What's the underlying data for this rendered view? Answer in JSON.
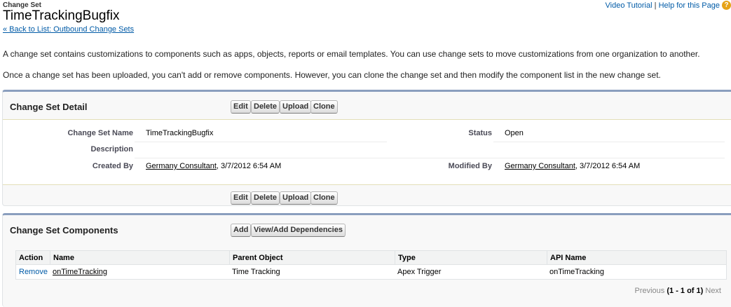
{
  "header": {
    "crumb": "Change Set",
    "title": "TimeTrackingBugfix",
    "back_link": "« Back to List: Outbound Change Sets"
  },
  "help": {
    "video": "Video Tutorial",
    "sep": "|",
    "help_page": "Help for this Page",
    "icon": "help-icon"
  },
  "intro": {
    "p1": "A change set contains customizations to components such as apps, objects, reports or email templates. You can use change sets to move customizations from one organization to another.",
    "p2": "Once a change set has been uploaded, you can't add or remove components. However, you can clone the change set and then modify the component list in the new change set."
  },
  "detail": {
    "title": "Change Set Detail",
    "buttons": {
      "edit": "Edit",
      "delete": "Delete",
      "upload": "Upload",
      "clone": "Clone"
    },
    "fields": {
      "name_label": "Change Set Name",
      "name_value": "TimeTrackingBugfix",
      "status_label": "Status",
      "status_value": "Open",
      "description_label": "Description",
      "created_label": "Created By",
      "created_user": "Germany Consultant",
      "created_date": ", 3/7/2012 6:54 AM",
      "modified_label": "Modified By",
      "modified_user": "Germany Consultant",
      "modified_date": ", 3/7/2012 6:54 AM"
    }
  },
  "components": {
    "title": "Change Set Components",
    "buttons": {
      "add": "Add",
      "dependencies": "View/Add Dependencies"
    },
    "columns": [
      "Action",
      "Name",
      "Parent Object",
      "Type",
      "API Name"
    ],
    "rows": [
      {
        "action": "Remove",
        "name": "onTimeTracking",
        "parent": "Time Tracking",
        "type": "Apex Trigger",
        "api": "onTimeTracking"
      }
    ],
    "pager": {
      "prev": "Previous",
      "range": "(1 - 1 of 1)",
      "next": "Next"
    }
  },
  "colors": {
    "link": "#015ba7",
    "section_border": "#8a9ebe",
    "help_icon": "#e6a317"
  }
}
